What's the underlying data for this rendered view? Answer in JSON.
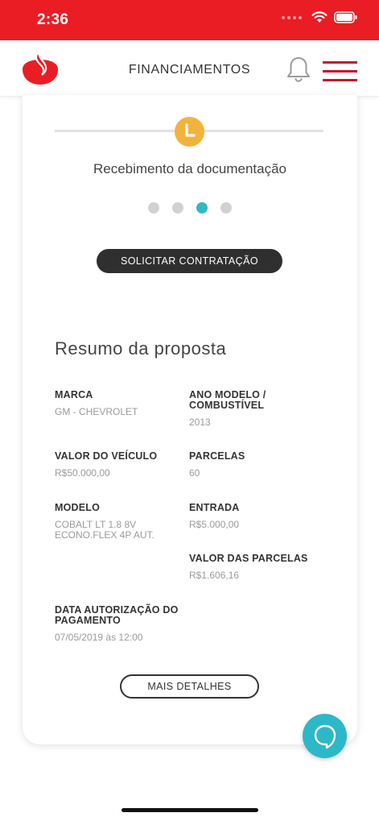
{
  "status": {
    "time": "2:36"
  },
  "header": {
    "title": "FINANCIAMENTOS"
  },
  "progress": {
    "step_label": "Recebimento da documentação",
    "dots_total": 4,
    "dots_active_index": 2
  },
  "actions": {
    "request_label": "SOLICITAR CONTRATAÇÃO",
    "details_label": "MAIS DETALHES"
  },
  "summary": {
    "title": "Resumo da proposta",
    "marca": {
      "label": "MARCA",
      "value": "GM - CHEVROLET"
    },
    "ano_modelo": {
      "label": "ANO MODELO / COMBUSTÍVEL",
      "value": "2013"
    },
    "valor_veiculo": {
      "label": "VALOR DO VEÍCULO",
      "value": "R$50.000,00"
    },
    "parcelas": {
      "label": "PARCELAS",
      "value": "60"
    },
    "modelo": {
      "label": "MODELO",
      "value": "COBALT LT 1.8 8V ECONO.FLEX 4P AUT."
    },
    "entrada": {
      "label": "ENTRADA",
      "value": "R$5.000,00"
    },
    "valor_parcelas": {
      "label": "VALOR DAS PARCELAS",
      "value": "R$1.606,16"
    },
    "data_autorizacao": {
      "label": "DATA AUTORIZAÇÃO DO PAGAMENTO",
      "value": "07/05/2019 às 12:00"
    }
  },
  "icons": {
    "logo": "santander-flame-logo",
    "notifications": "bell-icon",
    "menu": "hamburger-menu-icon",
    "step": "clock-icon",
    "chat": "chat-bubble-icon"
  },
  "colors": {
    "brand_red": "#ea1d25",
    "step_yellow": "#f2b33d",
    "dot_active": "#32b9c1",
    "chat_fab": "#2cb8c8"
  }
}
